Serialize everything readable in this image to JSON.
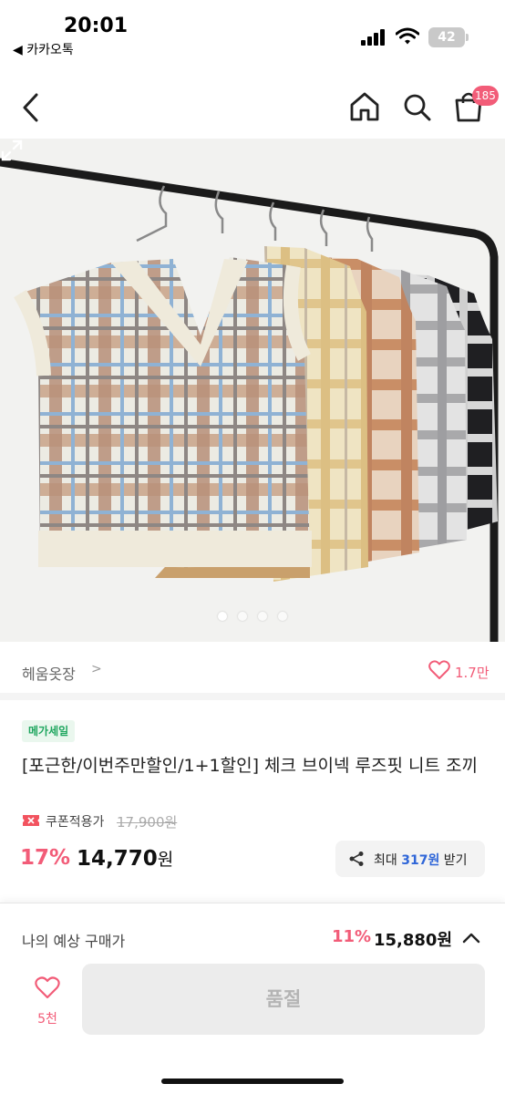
{
  "status_bar": {
    "time": "20:01",
    "back_app": "◀ 카카오톡",
    "battery": "42"
  },
  "nav": {
    "cart_count": "185",
    "icons": [
      "back-arrow-icon",
      "home-icon",
      "search-icon",
      "shopping-bag-icon"
    ]
  },
  "gallery": {
    "page_count": 4,
    "active_index": 0
  },
  "shop": {
    "name": "헤움옷장",
    "chevron": ">",
    "like_count": "1.7만"
  },
  "product": {
    "badge": "메가세일",
    "title": "[포근한/이번주만할인/1+1할인] 체크 브이넥 루즈핏 니트 조끼",
    "coupon_label": "쿠폰적용가",
    "original_price": "17,900원",
    "discount": "17%",
    "price": "14,770",
    "currency": "원"
  },
  "share": {
    "prefix": "최대",
    "points": "317원",
    "suffix": "받기"
  },
  "bottom_bar": {
    "expected_label": "나의 예상 구매가",
    "expected_discount": "11%",
    "expected_price": "15,880원",
    "wish_count": "5천",
    "soldout_label": "품절"
  },
  "colors": {
    "accent": "#f25c78",
    "badge_green": "#1fa65f",
    "point_blue": "#2f66d8",
    "disabled_bg": "#ececec"
  }
}
